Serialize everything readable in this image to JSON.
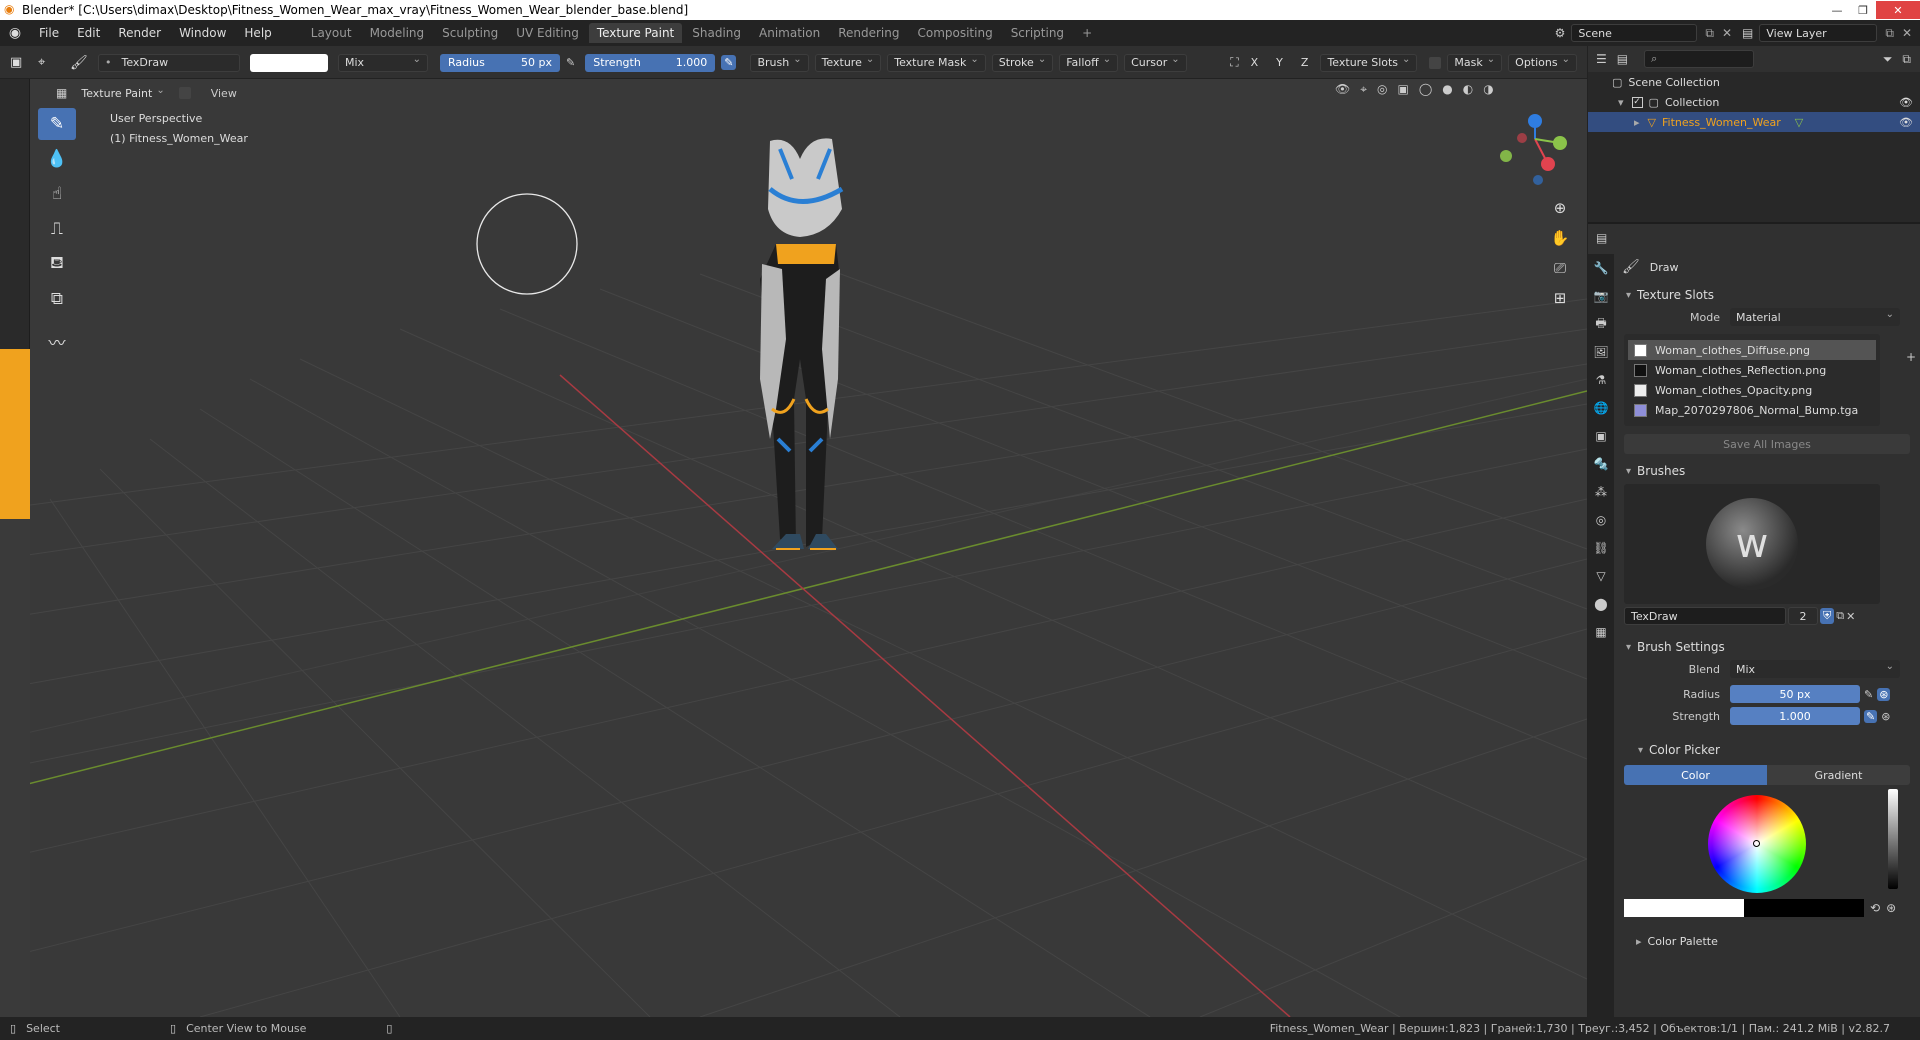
{
  "window": {
    "title": "Blender* [C:\\Users\\dimax\\Desktop\\Fitness_Women_Wear_max_vray\\Fitness_Women_Wear_blender_base.blend]"
  },
  "menu": [
    "File",
    "Edit",
    "Render",
    "Window",
    "Help"
  ],
  "workspaces": [
    "Layout",
    "Modeling",
    "Sculpting",
    "UV Editing",
    "Texture Paint",
    "Shading",
    "Animation",
    "Rendering",
    "Compositing",
    "Scripting"
  ],
  "active_workspace": "Texture Paint",
  "scene": "Scene",
  "view_layer": "View Layer",
  "tool_header": {
    "brush_name": "TexDraw",
    "blend": "Mix",
    "radius_label": "Radius",
    "radius_value": "50 px",
    "strength_label": "Strength",
    "strength_value": "1.000",
    "menus": [
      "Brush",
      "Texture",
      "Texture Mask",
      "Stroke",
      "Falloff",
      "Cursor"
    ],
    "axes": [
      "X",
      "Y",
      "Z"
    ],
    "texture_slots": "Texture Slots",
    "mask": "Mask",
    "options": "Options"
  },
  "viewport_header": {
    "mode": "Texture Paint",
    "view": "View"
  },
  "viewport": {
    "line1": "User Perspective",
    "line2": "(1) Fitness_Women_Wear"
  },
  "outliner": {
    "root": "Scene Collection",
    "collection": "Collection",
    "object": "Fitness_Women_Wear"
  },
  "properties": {
    "tool": "Draw",
    "texture_slots_title": "Texture Slots",
    "mode_label": "Mode",
    "mode_value": "Material",
    "slots": [
      "Woman_clothes_Diffuse.png",
      "Woman_clothes_Reflection.png",
      "Woman_clothes_Opacity.png",
      "Map_2070297806_Normal_Bump.tga"
    ],
    "save_all": "Save All Images",
    "brushes_title": "Brushes",
    "brush_name": "TexDraw",
    "brush_users": "2",
    "brush_settings_title": "Brush Settings",
    "blend_label": "Blend",
    "blend_value": "Mix",
    "radius_label": "Radius",
    "radius_value": "50 px",
    "strength_label": "Strength",
    "strength_value": "1.000",
    "color_picker_title": "Color Picker",
    "color_tab": "Color",
    "gradient_tab": "Gradient",
    "color_palette_title": "Color Palette"
  },
  "statusbar": {
    "select": "Select",
    "center": "Center View to Mouse",
    "info": "Fitness_Women_Wear | Вершин:1,823 | Граней:1,730 | Треуг.:3,452 | Объектов:1/1 | Пам.: 241.2 MiB | v2.82.7"
  },
  "colors": {
    "accent": "#4772b3",
    "selection": "#334d80",
    "axis_x": "#e0434f",
    "axis_y": "#8bc34a",
    "axis_z": "#2f7de1"
  }
}
